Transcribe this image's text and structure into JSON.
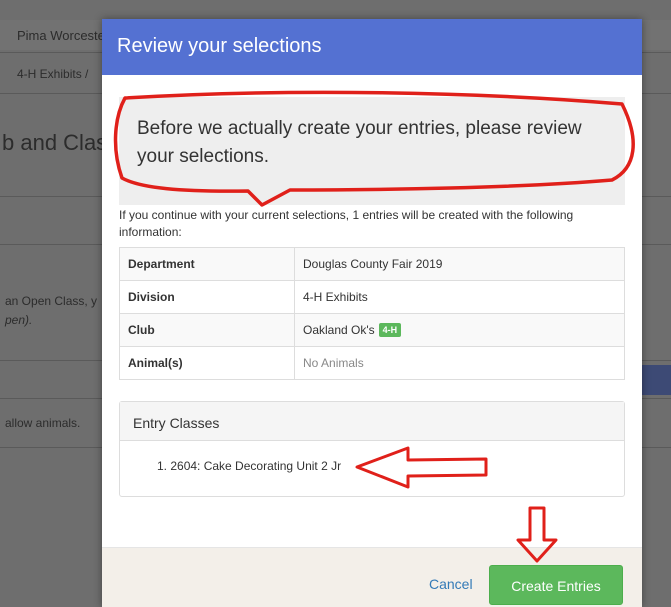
{
  "background": {
    "breadcrumb_top": "Pima Worceste",
    "breadcrumb_path": "4-H Exhibits /",
    "section_heading": "b and Class",
    "open_class_line1": "an Open Class, y",
    "open_class_line2": "pen).",
    "allow_animals": "allow animals."
  },
  "modal": {
    "title": "Review your selections",
    "callout_text": "Before we actually create your entries, please review your selections.",
    "intro_text": "If you continue with your current selections, 1 entries will be created with the following information:",
    "rows": [
      {
        "key": "Department",
        "value": "Douglas County Fair 2019"
      },
      {
        "key": "Division",
        "value": "4-H Exhibits"
      },
      {
        "key": "Club",
        "value": "Oakland Ok's",
        "badge": "4-H"
      },
      {
        "key": "Animal(s)",
        "value": "No Animals"
      }
    ],
    "entry_classes_title": "Entry Classes",
    "entry_item": "1. 2604: Cake Decorating Unit 2 Jr",
    "cancel_label": "Cancel",
    "create_label": "Create Entries"
  },
  "colors": {
    "header": "#5471d2",
    "create_button": "#5cb85c",
    "annotation": "#e0201a"
  }
}
